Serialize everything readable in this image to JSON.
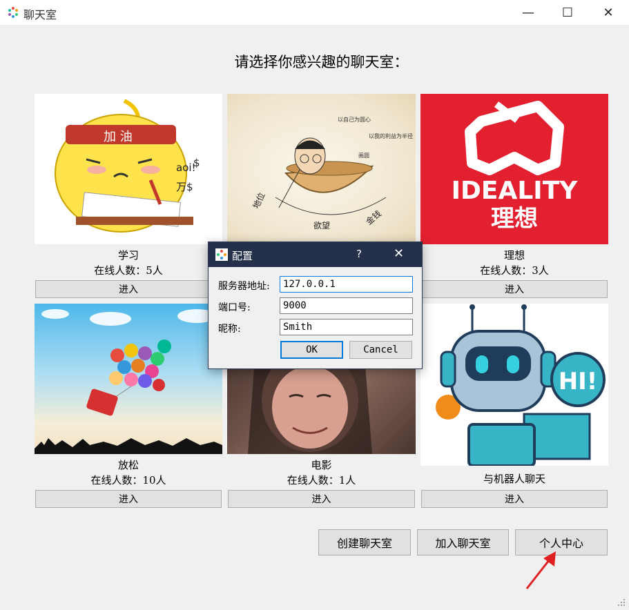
{
  "window": {
    "title": "聊天室",
    "minimize": "—",
    "maximize": "☐",
    "close": "✕"
  },
  "heading": "请选择你感兴趣的聊天室：",
  "rooms": [
    {
      "name": "学习",
      "online": "在线人数：5人",
      "enter": "进入",
      "image_text": [
        "加 油",
        "aoi!",
        "万$",
        "$"
      ]
    },
    {
      "name": "",
      "online": "",
      "enter": "",
      "image_text": [
        "以自己为圆心",
        "以我的利益为半径",
        "画圆",
        "地位",
        "欲望",
        "金钱"
      ]
    },
    {
      "name": "理想",
      "online": "在线人数：3人",
      "enter": "进入",
      "image_text": [
        "IDEALITY",
        "理想"
      ]
    },
    {
      "name": "放松",
      "online": "在线人数：10人",
      "enter": "进入"
    },
    {
      "name": "电影",
      "online": "在线人数：1人",
      "enter": "进入"
    },
    {
      "name": "与机器人聊天",
      "online": "",
      "enter": "进入",
      "image_text": [
        "HI!"
      ]
    }
  ],
  "actions": {
    "create": "创建聊天室",
    "join": "加入聊天室",
    "profile": "个人中心"
  },
  "dialog": {
    "title": "配置",
    "help": "?",
    "close": "✕",
    "server_label": "服务器地址:",
    "server_value": "127.0.0.1",
    "port_label": "端口号:",
    "port_value": "9000",
    "nick_label": "昵称:",
    "nick_value": "Smith",
    "ok": "OK",
    "cancel": "Cancel"
  },
  "colors": {
    "dialog_title_bg": "#25304b",
    "focus_blue": "#0078d7",
    "ideality_red": "#e2202f",
    "arrow_red": "#e02020"
  }
}
